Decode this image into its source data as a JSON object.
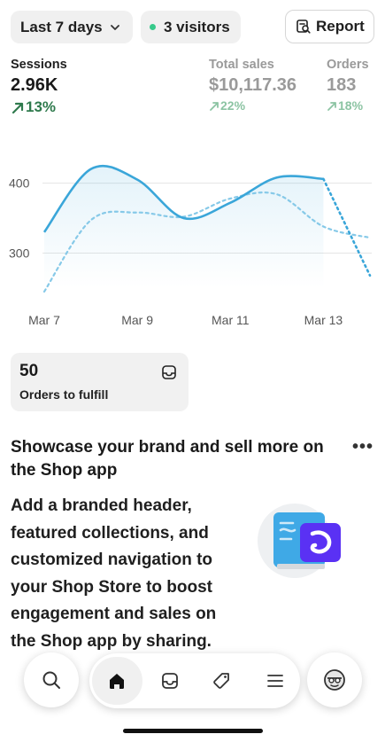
{
  "toolbar": {
    "range_label": "Last 7 days",
    "visitors_label": "3 visitors",
    "report_label": "Report"
  },
  "metrics": [
    {
      "label": "Sessions",
      "value": "2.96K",
      "change": "13%"
    },
    {
      "label": "Total sales",
      "value": "$10,117.36",
      "change": "22%"
    },
    {
      "label": "Orders",
      "value": "183",
      "change": "18%"
    }
  ],
  "chart_data": {
    "type": "line",
    "x": [
      "Mar 7",
      "Mar 8",
      "Mar 9",
      "Mar 10",
      "Mar 11",
      "Mar 12",
      "Mar 13",
      "Mar 14"
    ],
    "tick_labels": [
      "Mar 7",
      "Mar 9",
      "Mar 11",
      "Mar 13"
    ],
    "y_ticks": [
      300,
      400
    ],
    "ylim": [
      250,
      440
    ],
    "grid": true,
    "series": [
      {
        "style": "solid",
        "color": "#3aa6d9",
        "values": [
          330,
          420,
          405,
          350,
          372,
          408,
          406,
          268
        ]
      },
      {
        "style": "dashed",
        "color": "#86c9e8",
        "values": [
          245,
          347,
          358,
          352,
          378,
          384,
          338,
          322
        ]
      }
    ]
  },
  "fulfill": {
    "count": "50",
    "label": "Orders to fulfill"
  },
  "promo": {
    "title": "Showcase your brand and sell more on the Shop app",
    "more": "•••",
    "body": "Add a branded header, featured collections, and customized navigation to your Shop Store to boost engagement and sales on the Shop app by sharing."
  },
  "nav": {
    "items": [
      "search-icon",
      "home-icon",
      "inbox-icon",
      "tag-icon",
      "menu-icon",
      "avatar-icon"
    ],
    "active": "home"
  },
  "colors": {
    "accent": "#3aa6d9",
    "positive": "#2f7a4d",
    "status_dot": "#36c98a"
  }
}
